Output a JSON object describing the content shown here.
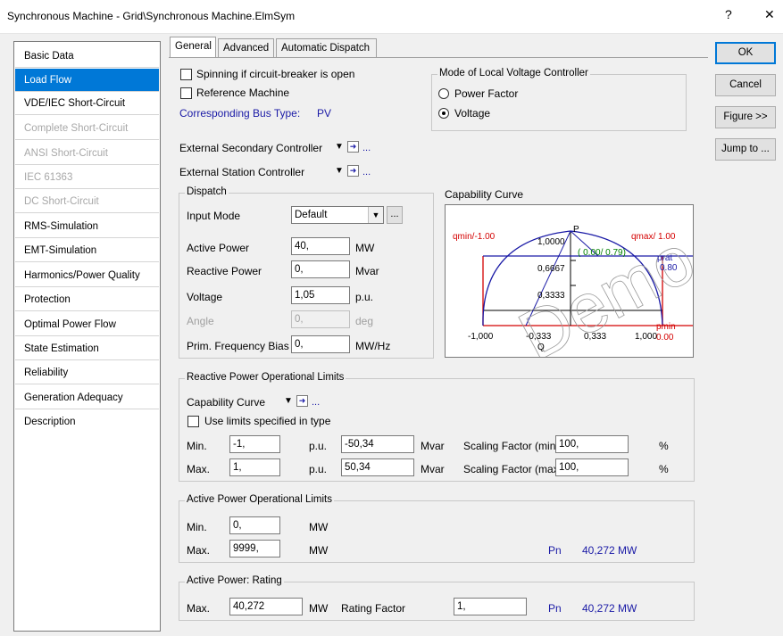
{
  "window": {
    "title": "Synchronous Machine - Grid\\Synchronous Machine.ElmSym",
    "help": "?",
    "close": "✕"
  },
  "sidebar": {
    "items": [
      {
        "label": "Basic Data",
        "state": "normal"
      },
      {
        "label": "Load Flow",
        "state": "selected"
      },
      {
        "label": "VDE/IEC Short-Circuit",
        "state": "normal"
      },
      {
        "label": "Complete Short-Circuit",
        "state": "disabled"
      },
      {
        "label": "ANSI Short-Circuit",
        "state": "disabled"
      },
      {
        "label": "IEC 61363",
        "state": "disabled"
      },
      {
        "label": "DC Short-Circuit",
        "state": "disabled"
      },
      {
        "label": "RMS-Simulation",
        "state": "normal"
      },
      {
        "label": "EMT-Simulation",
        "state": "normal"
      },
      {
        "label": "Harmonics/Power Quality",
        "state": "normal"
      },
      {
        "label": "Protection",
        "state": "normal"
      },
      {
        "label": "Optimal Power Flow",
        "state": "normal"
      },
      {
        "label": "State Estimation",
        "state": "normal"
      },
      {
        "label": "Reliability",
        "state": "normal"
      },
      {
        "label": "Generation Adequacy",
        "state": "normal"
      },
      {
        "label": "Description",
        "state": "normal"
      }
    ]
  },
  "tabs": [
    "General",
    "Advanced",
    "Automatic Dispatch"
  ],
  "buttons": {
    "ok": "OK",
    "cancel": "Cancel",
    "figure": "Figure >>",
    "jump": "Jump to ..."
  },
  "general": {
    "spinning_label": "Spinning if circuit-breaker is open",
    "reference_label": "Reference Machine",
    "bus_type_label": "Corresponding Bus Type:",
    "bus_type_value": "PV",
    "ext_secondary_label": "External Secondary Controller",
    "ext_station_label": "External Station Controller",
    "ellipsis": "..."
  },
  "voltage_controller": {
    "title": "Mode of Local Voltage Controller",
    "option_pf": "Power Factor",
    "option_voltage": "Voltage",
    "selected": "voltage"
  },
  "dispatch": {
    "title": "Dispatch",
    "input_mode_label": "Input Mode",
    "input_mode_value": "Default",
    "active_power_label": "Active Power",
    "active_power_value": "40,",
    "active_power_unit": "MW",
    "reactive_power_label": "Reactive Power",
    "reactive_power_value": "0,",
    "reactive_power_unit": "Mvar",
    "voltage_label": "Voltage",
    "voltage_value": "1,05",
    "voltage_unit": "p.u.",
    "angle_label": "Angle",
    "angle_value": "0,",
    "angle_unit": "deg",
    "freq_bias_label": "Prim. Frequency Bias",
    "freq_bias_value": "0,",
    "freq_bias_unit": "MW/Hz"
  },
  "capability": {
    "title": "Capability Curve",
    "qmin_label": "qmin/-1.00",
    "qmax_label": "qmax/ 1.00",
    "p_label": "P",
    "pmax_label": "1,0000",
    "op_point": "( 0.00/ 0.79)",
    "p2_label": "0,6667",
    "p3_label": "0,3333",
    "prat_label": "prat",
    "prat_value": "0.80",
    "pmin_label": "pmin",
    "pmin_value": "0.00",
    "x_ticks": [
      "-1,000",
      "-0,333",
      "0,333",
      "1,000"
    ],
    "q_label": "Q",
    "watermark": "Demo",
    "colors": {
      "limits": "#d40000",
      "curve": "#1a1aa6",
      "op": "#008000"
    }
  },
  "reactive_limits": {
    "title": "Reactive Power Operational Limits",
    "cap_curve_label": "Capability Curve",
    "use_type_label": "Use limits specified in type",
    "min_label": "Min.",
    "min_pu": "-1,",
    "min_mvar": "-50,34",
    "max_label": "Max.",
    "max_pu": "1,",
    "max_mvar": "50,34",
    "pu_unit": "p.u.",
    "mvar_unit": "Mvar",
    "scale_min_label": "Scaling Factor (min.)",
    "scale_min_value": "100,",
    "scale_max_label": "Scaling Factor (max.)",
    "scale_max_value": "100,",
    "pct": "%"
  },
  "active_limits": {
    "title": "Active Power Operational Limits",
    "min_label": "Min.",
    "min_value": "0,",
    "max_label": "Max.",
    "max_value": "9999,",
    "unit": "MW",
    "pn_label": "Pn",
    "pn_value": "40,272 MW"
  },
  "rating": {
    "title": "Active Power: Rating",
    "max_label": "Max.",
    "max_value": "40,272",
    "unit": "MW",
    "factor_label": "Rating Factor",
    "factor_value": "1,",
    "pn_label": "Pn",
    "pn_value": "40,272 MW"
  }
}
